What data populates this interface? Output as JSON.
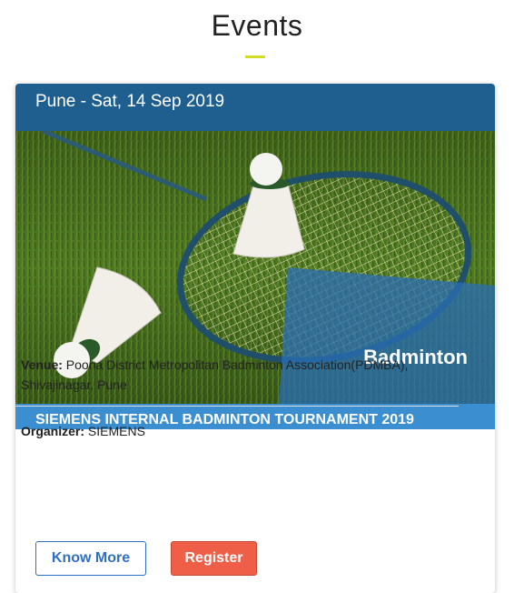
{
  "page": {
    "title": "Events",
    "accent": "#d4de2a"
  },
  "event": {
    "header": "Pune - Sat, 14 Sep 2019",
    "image_label": "Badminton",
    "title": "SIEMENS INTERNAL BADMINTON TOURNAMENT 2019",
    "venue_label": "Venue:",
    "venue_value": " Poona District Metropolitan Badminton Association(PDMBA), Shivajinagar, Pune",
    "organizer_label": "Organizer:",
    "organizer_value": " SIEMENS",
    "know_more_label": "Know More",
    "register_label": "Register",
    "colors": {
      "header": "#1f5f8f",
      "title_bar": "#3b8fd1",
      "register": "#ef5f47",
      "know_more": "#2e6fc4"
    }
  }
}
